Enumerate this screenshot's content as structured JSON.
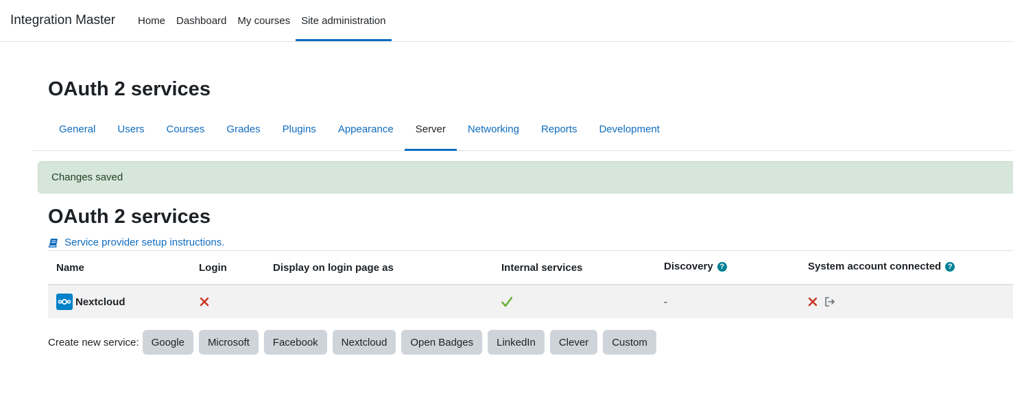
{
  "navbar": {
    "brand": "Integration Master",
    "items": [
      {
        "label": "Home"
      },
      {
        "label": "Dashboard"
      },
      {
        "label": "My courses"
      },
      {
        "label": "Site administration",
        "active": true
      }
    ]
  },
  "page_title": "OAuth 2 services",
  "secondary_nav": {
    "items": [
      {
        "label": "General"
      },
      {
        "label": "Users"
      },
      {
        "label": "Courses"
      },
      {
        "label": "Grades"
      },
      {
        "label": "Plugins"
      },
      {
        "label": "Appearance"
      },
      {
        "label": "Server",
        "active": true
      },
      {
        "label": "Networking"
      },
      {
        "label": "Reports"
      },
      {
        "label": "Development"
      }
    ]
  },
  "alert": {
    "text": "Changes saved",
    "type": "success"
  },
  "section_title": "OAuth 2 services",
  "doc_link": {
    "label": "Service provider setup instructions.",
    "icon": "book-icon"
  },
  "table": {
    "headers": {
      "name": "Name",
      "login": "Login",
      "display": "Display on login page as",
      "internal": "Internal services",
      "discovery": "Discovery",
      "system_account": "System account connected"
    },
    "rows": [
      {
        "name": "Nextcloud",
        "icon": "nextcloud-logo",
        "login": "cross-icon",
        "display": "",
        "internal": "check-icon",
        "discovery": "-",
        "system_account": "cross-icon",
        "action_icon": "sign-in-icon"
      }
    ]
  },
  "create_service": {
    "label": "Create new service:",
    "buttons": [
      "Google",
      "Microsoft",
      "Facebook",
      "Nextcloud",
      "Open Badges",
      "LinkedIn",
      "Clever",
      "Custom"
    ]
  },
  "colors": {
    "accent": "#0f6cbf",
    "alert_bg": "#d7e6da",
    "button_bg": "#ced4da",
    "row_bg": "#f2f2f2",
    "cross": "#ca3120",
    "check": "#6ab035",
    "help": "#008196"
  }
}
